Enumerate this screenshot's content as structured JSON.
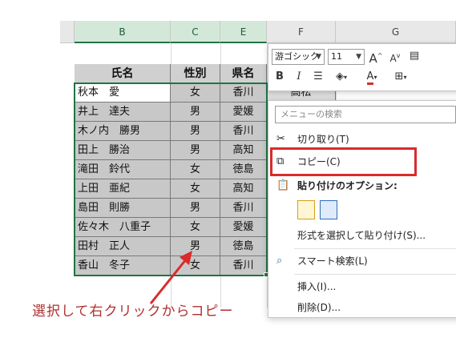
{
  "columns": [
    "B",
    "C",
    "E",
    "F",
    "G"
  ],
  "table": {
    "headers": [
      "氏名",
      "性別",
      "県名"
    ],
    "rows": [
      {
        "name": "秋本　愛",
        "gender": "女",
        "pref": "香川",
        "extra": "高松"
      },
      {
        "name": "井上　達夫",
        "gender": "男",
        "pref": "愛媛"
      },
      {
        "name": "木ノ内　勝男",
        "gender": "男",
        "pref": "香川"
      },
      {
        "name": "田上　勝治",
        "gender": "男",
        "pref": "高知"
      },
      {
        "name": "滝田　鈴代",
        "gender": "女",
        "pref": "徳島"
      },
      {
        "name": "上田　亜紀",
        "gender": "女",
        "pref": "高知"
      },
      {
        "name": "島田　則勝",
        "gender": "男",
        "pref": "香川"
      },
      {
        "name": "佐々木　八重子",
        "gender": "女",
        "pref": "愛媛"
      },
      {
        "name": "田村　正人",
        "gender": "男",
        "pref": "徳島"
      },
      {
        "name": "香山　冬子",
        "gender": "女",
        "pref": "香川"
      }
    ]
  },
  "mini_toolbar": {
    "font_name": "游ゴシック",
    "font_size": "11",
    "grow_font": "A",
    "shrink_font": "A",
    "bold": "B",
    "italic": "I",
    "font_color": "A"
  },
  "context_menu": {
    "search_placeholder": "メニューの検索",
    "items": [
      {
        "label": "切り取り(T)",
        "icon": "scissors-icon"
      },
      {
        "label": "コピー(C)",
        "icon": "copy-icon"
      },
      {
        "label": "貼り付けのオプション:",
        "icon": "paste-icon"
      },
      {
        "label": "形式を選択して貼り付け(S)...",
        "icon": ""
      },
      {
        "label": "スマート検索(L)",
        "icon": "search-icon"
      },
      {
        "label": "挿入(I)...",
        "icon": ""
      },
      {
        "label": "削除(D)...",
        "icon": ""
      }
    ]
  },
  "annotation": "選択して右クリックからコピー",
  "colors": {
    "highlight": "#d92b2b",
    "annotation": "#b03030",
    "selected_header": "#d3e8d9"
  }
}
